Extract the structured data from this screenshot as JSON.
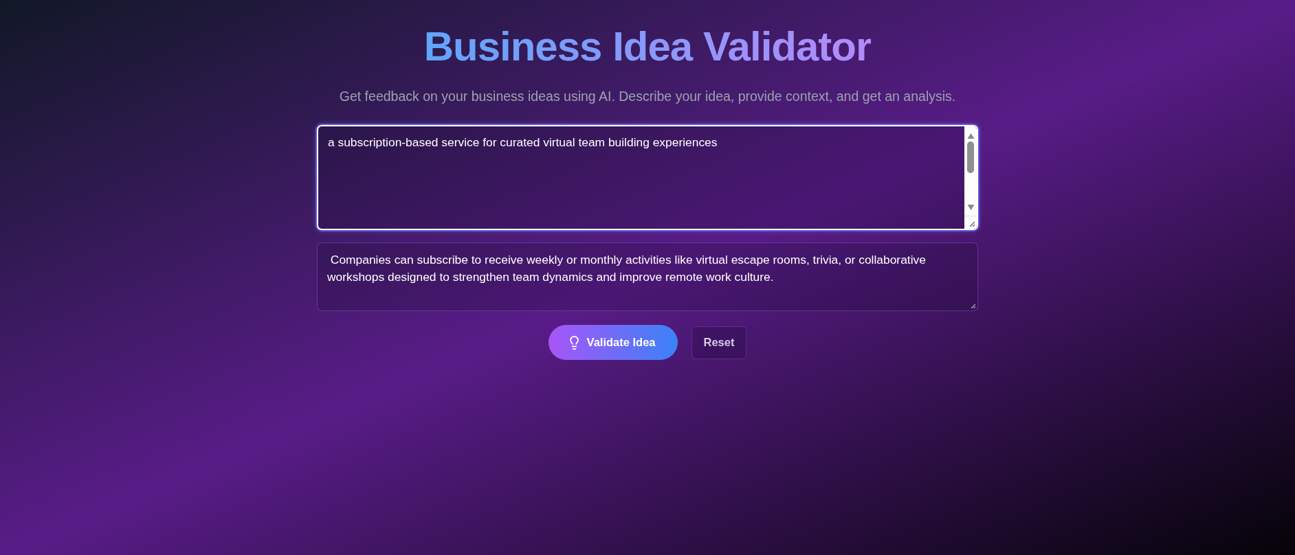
{
  "header": {
    "title": "Business Idea Validator",
    "subtitle": "Get feedback on your business ideas using AI. Describe your idea, provide context, and get an analysis."
  },
  "idea_field": {
    "value": "a subscription-based service for curated virtual team building experiences",
    "focused": true
  },
  "context_field": {
    "value": " Companies can subscribe to receive weekly or monthly activities like virtual escape rooms, trivia, or collaborative workshops designed to strengthen team dynamics and improve remote work culture.",
    "focused": false
  },
  "buttons": [
    {
      "kind": "primary",
      "label": "Validate Idea"
    },
    {
      "kind": "secondary",
      "label": "Reset"
    }
  ]
}
